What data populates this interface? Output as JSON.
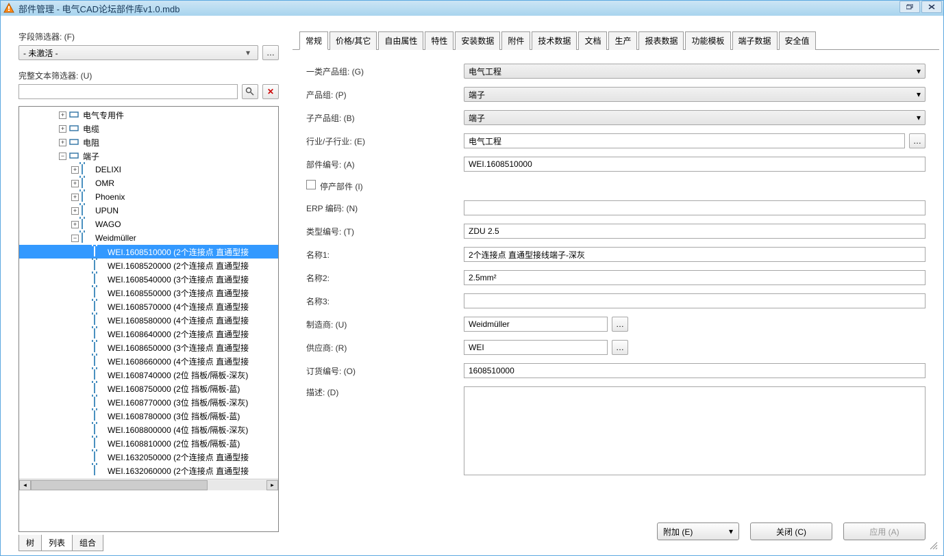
{
  "window": {
    "title": "部件管理 - 电气CAD论坛部件库v1.0.mdb"
  },
  "left": {
    "field_filter_label": "字段筛选器: (F)",
    "field_filter_value": "- 未激活 -",
    "full_text_label": "完整文本筛选器: (U)",
    "tabs": {
      "tree": "树",
      "list": "列表",
      "combo": "组合"
    }
  },
  "tree": {
    "top": [
      {
        "label": "电气专用件",
        "indent": 3,
        "exp": "+",
        "icon": "special"
      },
      {
        "label": "电缆",
        "indent": 3,
        "exp": "+",
        "icon": "cable"
      },
      {
        "label": "电阻",
        "indent": 3,
        "exp": "+",
        "icon": "resistor"
      },
      {
        "label": "端子",
        "indent": 3,
        "exp": "-",
        "icon": "terminal"
      }
    ],
    "brands": [
      {
        "label": "DELIXI",
        "exp": "+"
      },
      {
        "label": "OMR",
        "exp": "+"
      },
      {
        "label": "Phoenix",
        "exp": "+"
      },
      {
        "label": "UPUN",
        "exp": "+"
      },
      {
        "label": "WAGO",
        "exp": "+"
      },
      {
        "label": "Weidmüller",
        "exp": "-"
      }
    ],
    "parts": [
      "WEI.1608510000 (2个连接点 直通型接",
      "WEI.1608520000 (2个连接点 直通型接",
      "WEI.1608540000 (3个连接点 直通型接",
      "WEI.1608550000 (3个连接点 直通型接",
      "WEI.1608570000 (4个连接点 直通型接",
      "WEI.1608580000 (4个连接点 直通型接",
      "WEI.1608640000 (2个连接点 直通型接",
      "WEI.1608650000 (3个连接点 直通型接",
      "WEI.1608660000 (4个连接点 直通型接",
      "WEI.1608740000 (2位 挡板/隔板-深灰)",
      "WEI.1608750000 (2位 挡板/隔板-蓝)",
      "WEI.1608770000 (3位 挡板/隔板-深灰)",
      "WEI.1608780000 (3位 挡板/隔板-蓝)",
      "WEI.1608800000 (4位 挡板/隔板-深灰)",
      "WEI.1608810000 (2位 挡板/隔板-蓝)",
      "WEI.1632050000 (2个连接点 直通型接",
      "WEI.1632060000 (2个连接点 直通型接"
    ]
  },
  "tabs": [
    "常规",
    "价格/其它",
    "自由属性",
    "特性",
    "安装数据",
    "附件",
    "技术数据",
    "文档",
    "生产",
    "报表数据",
    "功能模板",
    "端子数据",
    "安全值"
  ],
  "form": {
    "group1_label": "一类产品组: (G)",
    "group1_value": "电气工程",
    "group2_label": "产品组: (P)",
    "group2_value": "端子",
    "group3_label": "子产品组: (B)",
    "group3_value": "端子",
    "industry_label": "行业/子行业: (E)",
    "industry_value": "电气工程",
    "partno_label": "部件编号: (A)",
    "partno_value": "WEI.1608510000",
    "discont_label": "停产部件 (I)",
    "erp_label": "ERP 编码: (N)",
    "erp_value": "",
    "type_label": "类型编号: (T)",
    "type_value": "ZDU 2.5",
    "name1_label": "名称1:",
    "name1_value": "2个连接点 直通型接线端子-深灰",
    "name2_label": "名称2:",
    "name2_value": "2.5mm²",
    "name3_label": "名称3:",
    "name3_value": "",
    "mfr_label": "制造商: (U)",
    "mfr_value": "Weidmüller",
    "sup_label": "供应商: (R)",
    "sup_value": "WEI",
    "order_label": "订货编号: (O)",
    "order_value": "1608510000",
    "desc_label": "描述: (D)"
  },
  "buttons": {
    "append": "附加 (E)",
    "close": "关闭 (C)",
    "apply": "应用 (A)"
  }
}
